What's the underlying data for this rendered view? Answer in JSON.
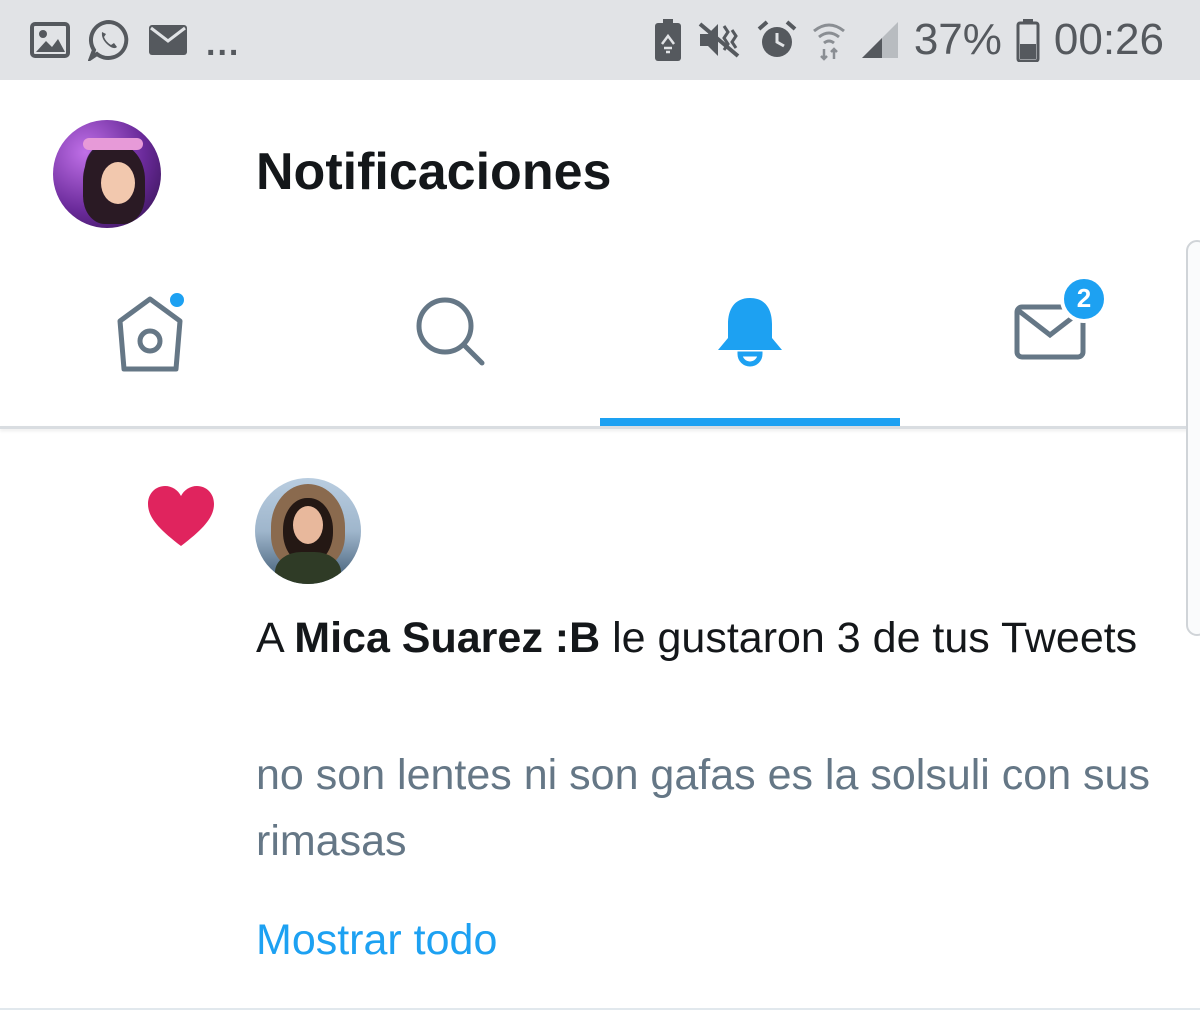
{
  "status_bar": {
    "left_icons": [
      "gallery-icon",
      "whatsapp-icon",
      "mail-icon"
    ],
    "overflow": "...",
    "right_icons": [
      "battery-saver-icon",
      "vibrate-icon",
      "alarm-icon",
      "wifi-icon",
      "signal-icon"
    ],
    "battery_percent": "37%",
    "time": "00:26"
  },
  "header": {
    "title": "Notificaciones"
  },
  "tabs": [
    {
      "name": "home",
      "icon": "home-icon",
      "has_dot": true
    },
    {
      "name": "search",
      "icon": "search-icon"
    },
    {
      "name": "notifications",
      "icon": "bell-icon",
      "active": true
    },
    {
      "name": "messages",
      "icon": "envelope-icon",
      "badge": "2"
    }
  ],
  "notification": {
    "icon": "heart-icon",
    "prefix": "A ",
    "user": "Mica Suarez :B",
    "suffix": " le gustaron 3 de tus Tweets",
    "tweet": "no son lentes ni son gafas es la solsuli con sus rimasas",
    "show_all": "Mostrar todo"
  },
  "colors": {
    "accent": "#1da1f2",
    "heart": "#e0245e",
    "muted_text": "#657786",
    "inactive_icon": "#657786",
    "statusbar_bg": "#e1e3e6"
  }
}
